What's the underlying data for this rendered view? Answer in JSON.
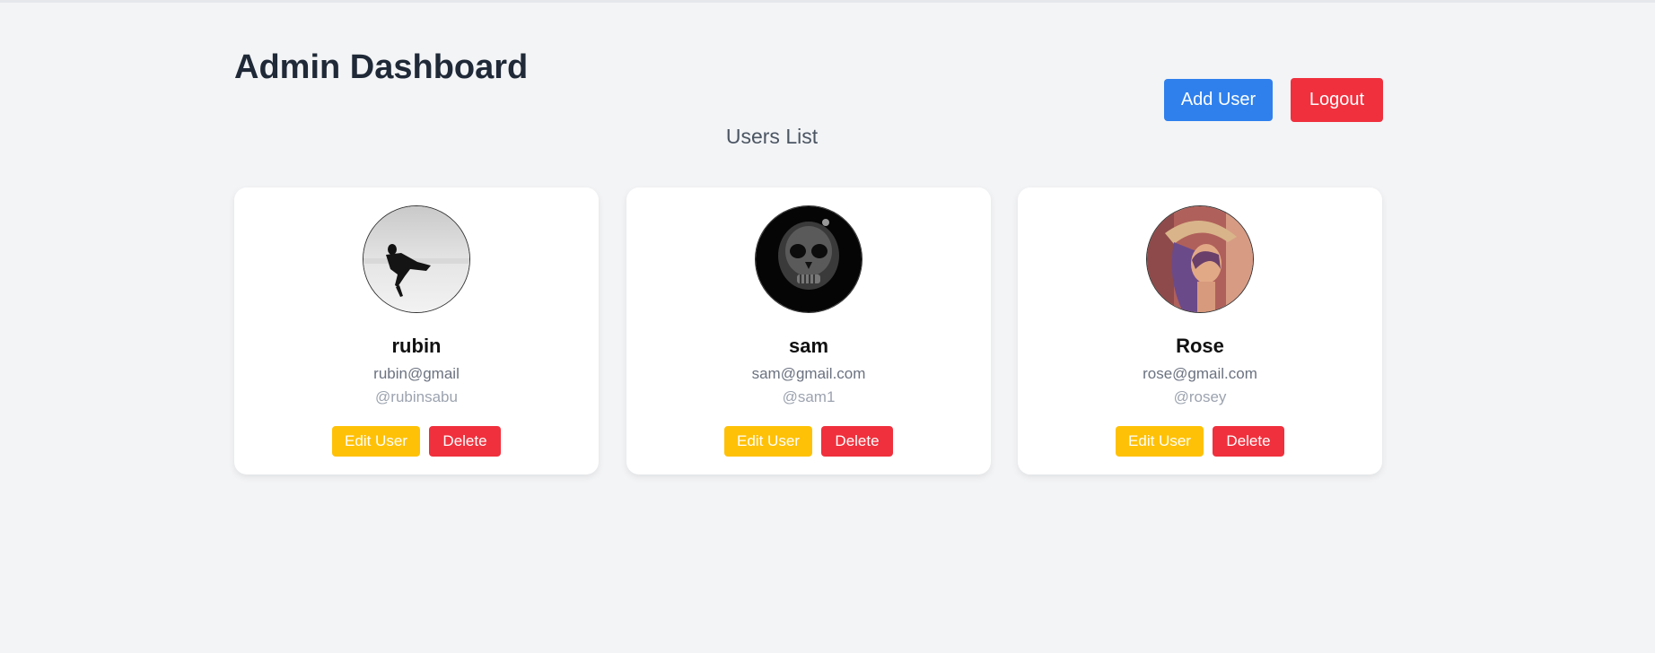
{
  "header": {
    "title": "Admin Dashboard",
    "add_user_label": "Add User",
    "logout_label": "Logout"
  },
  "users_section": {
    "title": "Users List"
  },
  "users": [
    {
      "name": "rubin",
      "email": "rubin@gmail",
      "username": "@rubinsabu",
      "avatar_icon": "person-photo-bw"
    },
    {
      "name": "sam",
      "email": "sam@gmail.com",
      "username": "@sam1",
      "avatar_icon": "dark-skull-photo"
    },
    {
      "name": "Rose",
      "email": "rose@gmail.com",
      "username": "@rosey",
      "avatar_icon": "portrait-photo"
    }
  ],
  "card_actions": {
    "edit_label": "Edit User",
    "delete_label": "Delete"
  },
  "colors": {
    "background": "#f3f4f6",
    "primary": "#2f80ed",
    "danger": "#f0303d",
    "warning": "#ffc107"
  }
}
